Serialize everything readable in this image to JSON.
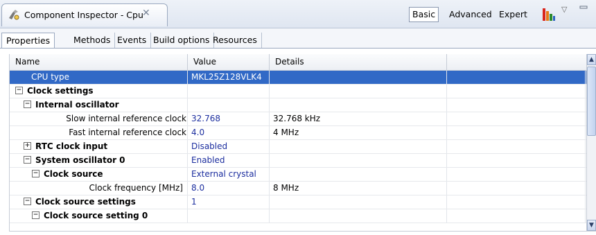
{
  "window": {
    "tab_title": "Component Inspector - Cpu",
    "tab_icon": "component-icon",
    "close_glyph": "✕"
  },
  "modes": {
    "basic": "Basic",
    "advanced": "Advanced",
    "expert": "Expert",
    "active": "Basic"
  },
  "subtabs": [
    "Properties",
    "Methods",
    "Events",
    "Build options",
    "Resources"
  ],
  "grid": {
    "headers": {
      "name": "Name",
      "value": "Value",
      "details": "Details"
    },
    "rows": [
      {
        "name": "CPU type",
        "value": "MKL25Z128VLK4",
        "details": "",
        "selected": true
      },
      {
        "name": "Clock settings",
        "value": "",
        "details": "",
        "expander": "−"
      },
      {
        "name": "Internal oscillator",
        "value": "",
        "details": "",
        "expander": "−"
      },
      {
        "name": "Slow internal reference clock",
        "value": "32.768",
        "details": "32.768 kHz"
      },
      {
        "name": "Fast internal reference clock",
        "value": "4.0",
        "details": "4 MHz"
      },
      {
        "name": "RTC clock input",
        "value": "Disabled",
        "details": "",
        "expander": "+"
      },
      {
        "name": "System oscillator 0",
        "value": "Enabled",
        "details": "",
        "expander": "−"
      },
      {
        "name": "Clock source",
        "value": "External crystal",
        "details": "",
        "expander": "−"
      },
      {
        "name": "Clock frequency [MHz]",
        "value": "8.0",
        "details": "8 MHz"
      },
      {
        "name": "Clock source settings",
        "value": "1",
        "details": "",
        "expander": "−"
      },
      {
        "name": "Clock source setting 0",
        "value": "",
        "details": "",
        "expander": "−"
      }
    ]
  },
  "colors": {
    "selection": "#3169c6",
    "value_text": "#1b2d9e"
  }
}
